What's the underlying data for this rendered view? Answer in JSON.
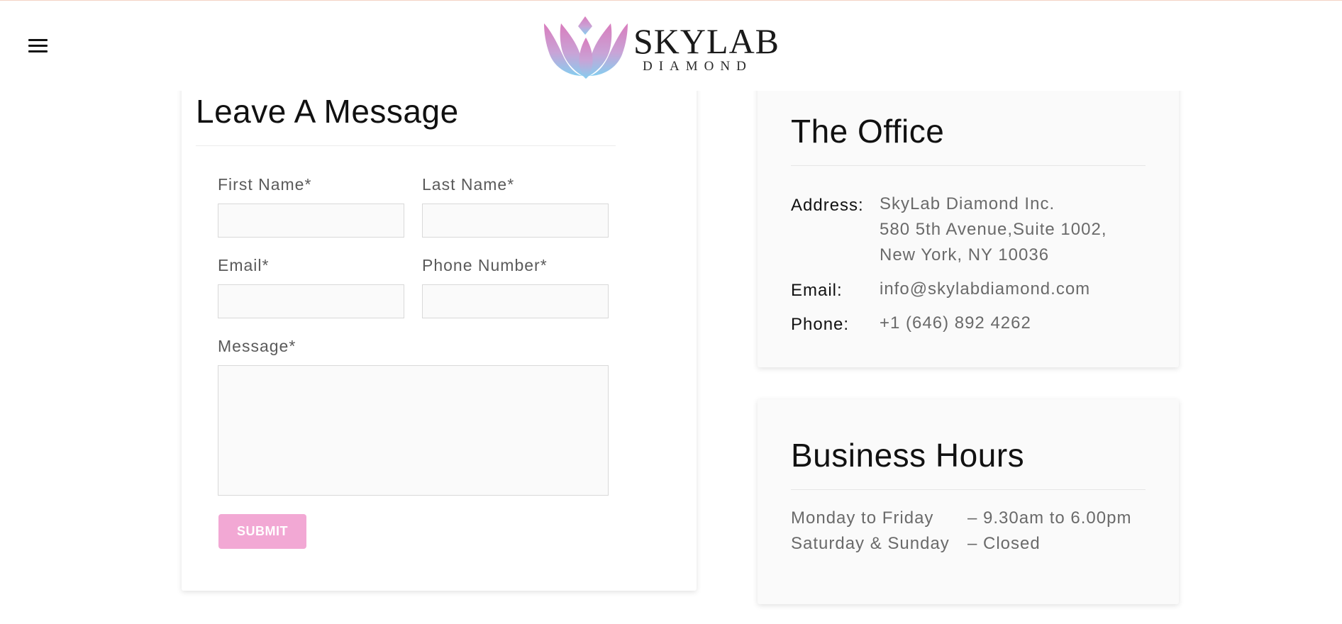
{
  "header": {
    "logo_word": "SKYLAB",
    "logo_sub": "DIAMOND",
    "menu_icon": "hamburger-menu-icon"
  },
  "form": {
    "title": "Leave A Message",
    "first_name_label": "First Name*",
    "last_name_label": "Last Name*",
    "email_label": "Email*",
    "phone_label": "Phone Number*",
    "message_label": "Message*",
    "first_name_value": "",
    "last_name_value": "",
    "email_value": "",
    "phone_value": "",
    "message_value": "",
    "submit_label": "SUBMIT"
  },
  "office": {
    "title": "The Office",
    "address_label": "Address:",
    "address_lines": [
      "SkyLab Diamond Inc.",
      "580 5th Avenue,Suite 1002,",
      "New York, NY 10036"
    ],
    "email_label": "Email:",
    "email_value": "info@skylabdiamond.com",
    "phone_label": "Phone:",
    "phone_value": "+1 (646) 892 4262"
  },
  "hours": {
    "title": "Business Hours",
    "rows": [
      {
        "day": "Monday to Friday",
        "time": "– 9.30am to 6.00pm"
      },
      {
        "day": "Saturday & Sunday",
        "time": "– Closed"
      }
    ]
  },
  "colors": {
    "submit_bg": "#f2a8d4",
    "logo_pink": "#d98ec8",
    "logo_blue": "#8fc9ec"
  }
}
